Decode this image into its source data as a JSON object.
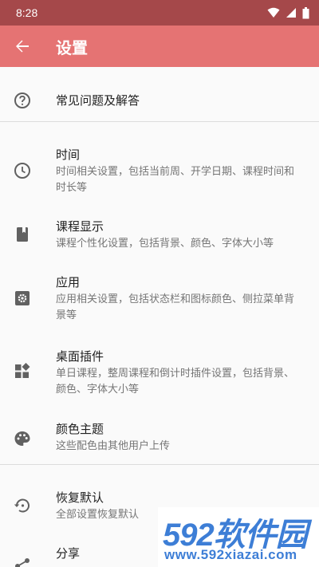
{
  "status_bar": {
    "time": "8:28"
  },
  "app_bar": {
    "title": "设置"
  },
  "items": [
    {
      "title": "常见问题及解答",
      "icon": "help-circle-icon"
    },
    {
      "title": "时间",
      "subtitle": "时间相关设置，包括当前周、开学日期、课程时间和时长等",
      "icon": "clock-icon"
    },
    {
      "title": "课程显示",
      "subtitle": "课程个性化设置，包括背景、颜色、字体大小等",
      "icon": "book-icon"
    },
    {
      "title": "应用",
      "subtitle": "应用相关设置，包括状态栏和图标颜色、侧拉菜单背景等",
      "icon": "settings-box-icon"
    },
    {
      "title": "桌面插件",
      "subtitle": "单日课程，整周课程和倒计时插件设置，包括背景、颜色、字体大小等",
      "icon": "widgets-icon"
    },
    {
      "title": "颜色主题",
      "subtitle": "这些配色由其他用户上传",
      "icon": "palette-icon"
    },
    {
      "title": "恢复默认",
      "subtitle": "全部设置恢复默认",
      "icon": "restore-icon"
    },
    {
      "title": "分享",
      "subtitle": "",
      "icon": "share-icon"
    }
  ],
  "watermark": {
    "logo": "592软件园",
    "url": "www.592xiazai.com"
  },
  "colors": {
    "status_bar": "#a5484a",
    "app_bar": "#e57373",
    "background": "#fafafa"
  }
}
